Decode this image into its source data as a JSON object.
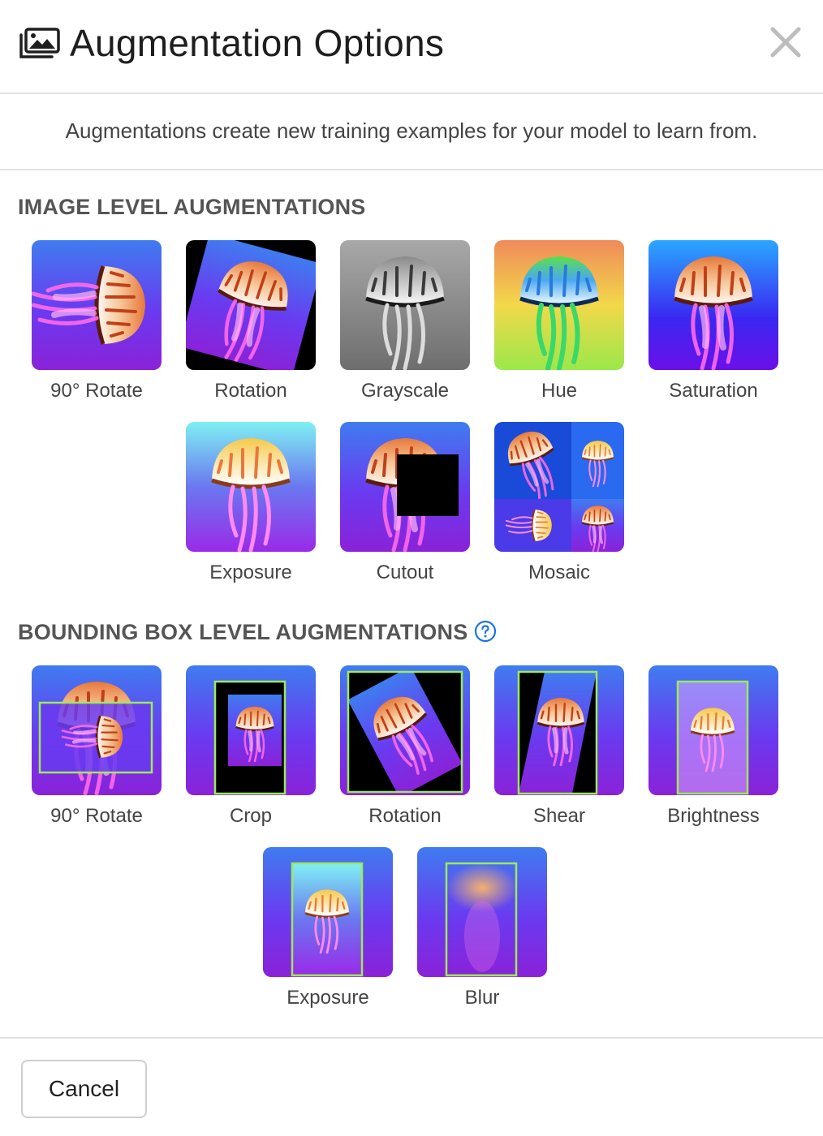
{
  "header": {
    "title": "Augmentation Options",
    "icon": "images-icon",
    "close_icon": "close-icon"
  },
  "description": "Augmentations create new training examples for your model to learn from.",
  "image_level": {
    "title": "IMAGE LEVEL AUGMENTATIONS",
    "items": [
      {
        "label": "90° Rotate"
      },
      {
        "label": "Rotation"
      },
      {
        "label": "Grayscale"
      },
      {
        "label": "Hue"
      },
      {
        "label": "Saturation"
      },
      {
        "label": "Exposure"
      },
      {
        "label": "Cutout"
      },
      {
        "label": "Mosaic"
      }
    ]
  },
  "bbox_level": {
    "title": "BOUNDING BOX LEVEL AUGMENTATIONS",
    "help_icon": "question-circle-icon",
    "items": [
      {
        "label": "90° Rotate"
      },
      {
        "label": "Crop"
      },
      {
        "label": "Rotation"
      },
      {
        "label": "Shear"
      },
      {
        "label": "Brightness"
      },
      {
        "label": "Exposure"
      },
      {
        "label": "Blur"
      }
    ]
  },
  "footer": {
    "cancel_label": "Cancel"
  },
  "colors": {
    "accent": "#1a73e8",
    "bbox": "#9dea5a",
    "text": "#444444",
    "divider": "#e2e2e2"
  }
}
